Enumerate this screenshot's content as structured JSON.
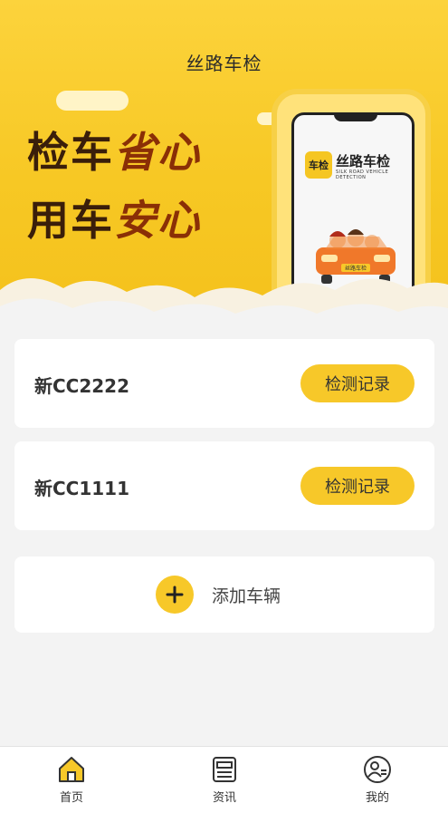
{
  "header": {
    "title": "丝路车检"
  },
  "banner": {
    "slogan_line1_a": "检车",
    "slogan_line1_b": "省心",
    "slogan_line2_a": "用车",
    "slogan_line2_b": "安心",
    "phone_badge": "车检",
    "phone_brand": "丝路车检",
    "phone_brand_sub": "SILK ROAD VEHICLE DETECTION",
    "car_plate": "丝路车检"
  },
  "vehicles": [
    {
      "plate": "新CC2222",
      "button": "检测记录"
    },
    {
      "plate": "新CC1111",
      "button": "检测记录"
    }
  ],
  "add_vehicle": {
    "label": "添加车辆",
    "icon": "plus-icon"
  },
  "tabbar": {
    "items": [
      {
        "label": "首页",
        "icon": "home-icon",
        "active": true
      },
      {
        "label": "资讯",
        "icon": "news-icon",
        "active": false
      },
      {
        "label": "我的",
        "icon": "profile-icon",
        "active": false
      }
    ]
  },
  "colors": {
    "accent": "#f7c829",
    "banner": "#fcd33c",
    "background": "#f3f3f3"
  }
}
